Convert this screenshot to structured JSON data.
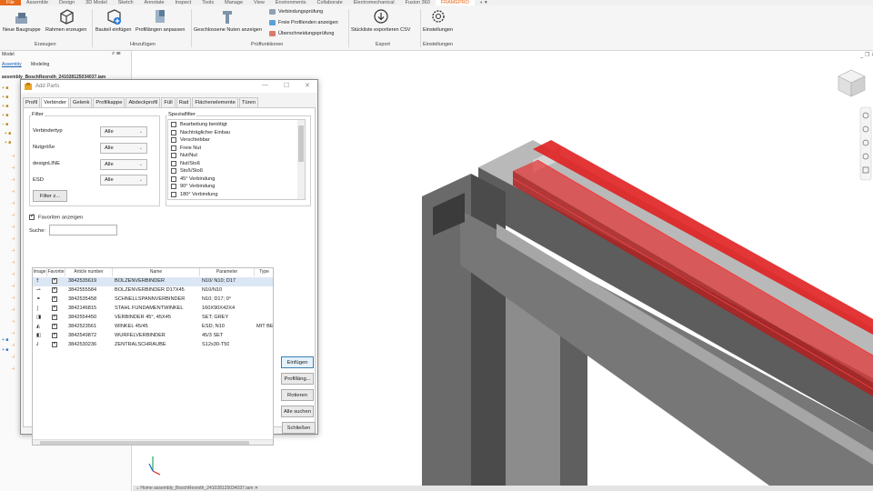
{
  "menubar": {
    "file": "File",
    "items": [
      "Assemble",
      "Design",
      "3D Model",
      "Sketch",
      "Annotate",
      "Inspect",
      "Tools",
      "Manage",
      "View",
      "Environments",
      "Collaborate",
      "Electromechanical",
      "Fusion 360"
    ],
    "active": "FRAMEPRO",
    "extra": "◐ ▾"
  },
  "ribbon": {
    "buttons": {
      "neue_baugruppe": "Neue Baugruppe",
      "rahmen_erzeugen": "Rahmen erzeugen",
      "bauteil_einfuegen": "Bauteil einfügen",
      "profillaengen": "Profillängen anpassen",
      "geschlossene_nuten": "Geschlossene Nuten anzeigen",
      "stueckliste": "Stückliste exportieren CSV",
      "einstellungen": "Einstellungen"
    },
    "small": {
      "verbindungspruefung": "Verbindungsprüfung",
      "freie_profilenden": "Freie Profilenden anzeigen",
      "ueberschneidung": "Überschneidungsprüfung"
    },
    "groups": {
      "erzeugen": "Erzeugen",
      "hinzufuegen": "Hinzufügen",
      "pruef": "Prüffunktionen",
      "export": "Export",
      "einstellungen": "Einstellungen"
    }
  },
  "browser": {
    "title": "Model",
    "tabs": {
      "assembly": "Assembly",
      "modeling": "Modeling"
    },
    "root": "assembly_BoschRexroth_241028125034037.iam"
  },
  "dialog": {
    "title": "Add Parts",
    "tabs": [
      "Profil",
      "Verbinder",
      "Gelenk",
      "Profilkappe",
      "Abdeckprofil",
      "Füll",
      "Rad",
      "Flächenelemente",
      "Türen"
    ],
    "filter": {
      "legend": "Filter",
      "verbindertyp": "Verbindertyp",
      "nutgroesse": "Nutgröße",
      "designline": "designLINE",
      "esd": "ESD",
      "alle": "Alle",
      "filter_btn": "Filter z..."
    },
    "spezial": {
      "legend": "Spezialfilter",
      "items": [
        "Bearbeitung benötigt",
        "Nachträglicher Einbau",
        "Verschiebbar",
        "Freie Nut",
        "Nut/Nut",
        "Nut/Stoß",
        "Stoß/Stoß",
        "45° Verbindung",
        "90° Verbindung",
        "180° Verbindung"
      ]
    },
    "favoriten": "Favoriten anzeigen",
    "suche": "Suche:",
    "grid": {
      "headers": [
        "Image",
        "Favorite",
        "Article number",
        "Name",
        "Parameter",
        "Type"
      ],
      "rows": [
        {
          "icon": "⥉",
          "article": "3842535619",
          "name": "BOLZENVERBINDER",
          "parameter": "N10/ N10; D17",
          "type": ""
        },
        {
          "icon": "⊸",
          "article": "3842555584",
          "name": "BOLZENVERBINDER D17X45",
          "parameter": "N10/N10",
          "type": ""
        },
        {
          "icon": "⚭",
          "article": "3842535458",
          "name": "SCHNELLSPANNVERBINDER",
          "parameter": "N10; D17; 0°",
          "type": ""
        },
        {
          "icon": "⌡",
          "article": "3842146815",
          "name": "STAHL FUNDAMENTWINKEL",
          "parameter": "160X90X42X4",
          "type": ""
        },
        {
          "icon": "◨",
          "article": "3842554450",
          "name": "VERBINDER 45°, 45X45",
          "parameter": "SET; GREY",
          "type": ""
        },
        {
          "icon": "◭",
          "article": "3842523561",
          "name": "WINKEL 45/45",
          "parameter": "ESD; N10",
          "type": "MIT BEFE"
        },
        {
          "icon": "◧",
          "article": "3842549872",
          "name": "WÜRFELVERBINDER",
          "parameter": "45/3 SET",
          "type": ""
        },
        {
          "icon": "⫰",
          "article": "3842530236",
          "name": "ZENTRALSCHRAUBE",
          "parameter": "S12x30-T50",
          "type": ""
        }
      ]
    },
    "buttons": {
      "einfuegen": "Einfügen",
      "profillaenge": "Profilläng...",
      "rotieren": "Rotieren",
      "alle_suchen": "Alle suchen",
      "schliessen": "Schließen"
    }
  },
  "doc_tab": "⌂ Home    assembly_BoschRexroth_241028125034037.iam  ✕"
}
